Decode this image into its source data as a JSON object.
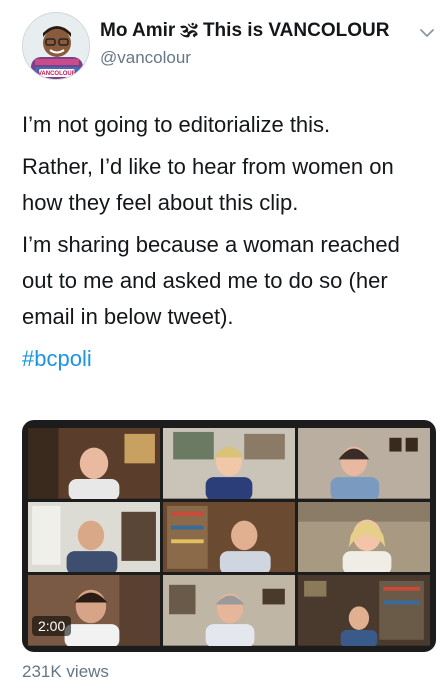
{
  "tweet": {
    "display_name": "Mo Amir 🕉 This is VANCOLOUR",
    "handle": "@vancolour",
    "paragraphs": [
      "I’m not going to editorialize this.",
      "Rather, I’d like to hear from women on how they feel about this clip.",
      "I’m sharing because a woman reached out to me and asked me to do so (her email in below tweet)."
    ],
    "hashtag": "#bcpoli",
    "avatar_badge": "VANCOLOUR"
  },
  "media": {
    "timer": "2:00",
    "views": "231K views"
  },
  "icons": {
    "menu": "chevron-down-icon"
  },
  "colors": {
    "text": "#14171a",
    "secondary": "#657786",
    "link": "#1b95e0",
    "active_speaker_border": "#e5e24b"
  }
}
